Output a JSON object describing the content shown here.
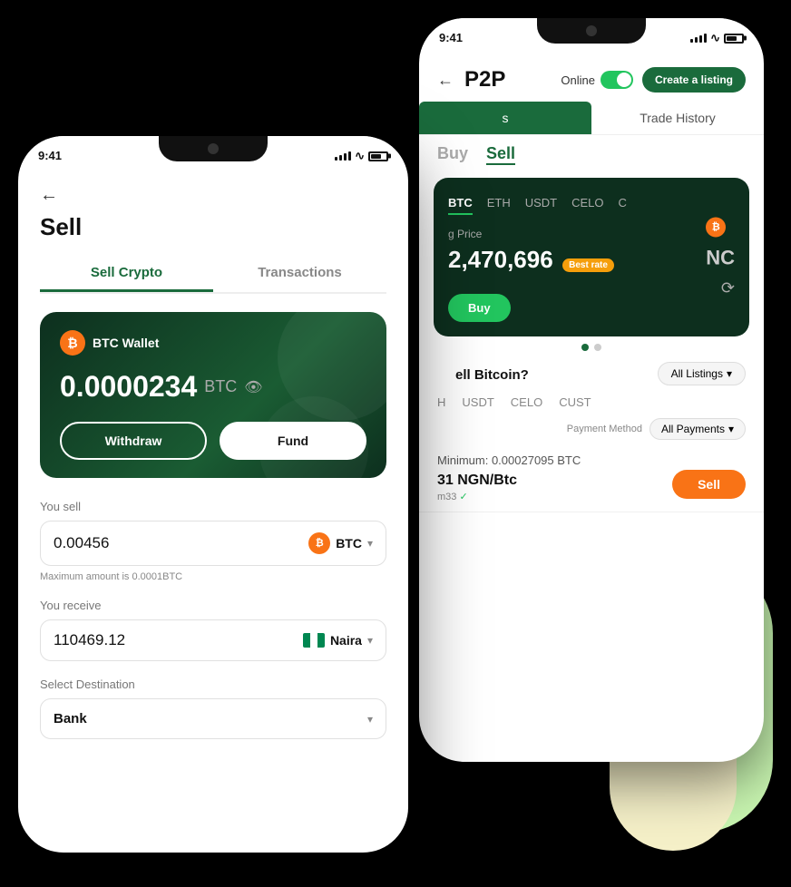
{
  "background": {
    "blob_color": "#c8f5b0",
    "blob_yellow_color": "#f5f0c8"
  },
  "back_phone": {
    "status_time": "9:41",
    "header": {
      "title": "P2P",
      "back_arrow": "←",
      "online_label": "Online",
      "create_listing_label": "Create a listing"
    },
    "tabs": [
      {
        "label": "s",
        "active": true
      },
      {
        "label": "Trade History",
        "active": false
      }
    ],
    "buy_sell": {
      "buy_label": "Buy",
      "sell_label": "Sell",
      "active": "Sell"
    },
    "dark_card": {
      "coins": [
        "BTC",
        "ETH",
        "USDT",
        "CELO",
        "C"
      ],
      "active_coin": "BTC",
      "price_label": "g Price",
      "price_value": "2,470,696",
      "best_rate": "Best rate",
      "buy_button": "Buy",
      "no_listings_right": "NC"
    },
    "dots": [
      {
        "active": true
      },
      {
        "active": false
      }
    ],
    "listings_section": {
      "title": "ell Bitcoin?",
      "all_listings_label": "All Listings",
      "coins": [
        "H",
        "USDT",
        "CELO",
        "CUST"
      ],
      "payment_method_label": "Payment Method",
      "all_payments_label": "All Payments",
      "listing": {
        "price_text": "Minimum: 0.00027095 BTC",
        "ngn_rate": "31 NGN/Btc",
        "seller": "m33",
        "sell_button_label": "Sell"
      }
    }
  },
  "front_phone": {
    "status_time": "9:41",
    "header": {
      "back_arrow": "←",
      "title": "Sell"
    },
    "tabs": [
      {
        "label": "Sell Crypto",
        "active": true
      },
      {
        "label": "Transactions",
        "active": false
      }
    ],
    "wallet_card": {
      "coin_icon": "₿",
      "wallet_name": "BTC Wallet",
      "balance": "0.0000234",
      "currency": "BTC",
      "withdraw_label": "Withdraw",
      "fund_label": "Fund"
    },
    "sell_section": {
      "you_sell_label": "You sell",
      "sell_amount": "0.00456",
      "sell_currency": "BTC",
      "max_note": "Maximum amount is 0.0001BTC",
      "you_receive_label": "You receive",
      "receive_amount": "110469.12",
      "receive_currency": "Naira",
      "destination_label": "Select Destination",
      "destination_value": "Bank",
      "chevron": "▾"
    }
  }
}
